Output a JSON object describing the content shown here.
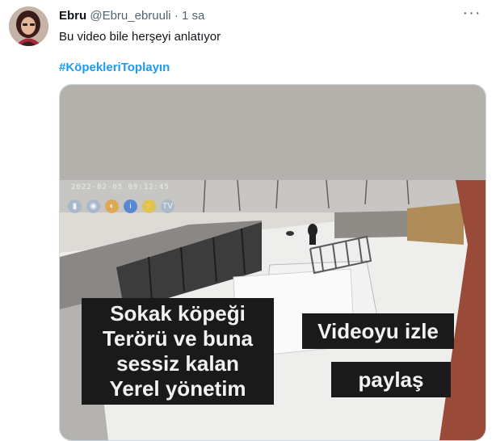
{
  "tweet": {
    "author_name": "Ebru",
    "author_handle": "@Ebru_ebruuli",
    "separator": "·",
    "time": "1 sa",
    "text": "Bu video bile herşeyi anlatıyor",
    "hashtag": "#KöpekleriToplayın",
    "more_icon": "more-horizontal-icon"
  },
  "video": {
    "timestamp": "2022-02-05 09:12:45",
    "caption_left": "Sokak köpeği\nTerörü ve buna\nsessiz kalan\nYerel yönetim",
    "caption_watch": "Videoyu izle",
    "caption_share": "paylaş"
  }
}
